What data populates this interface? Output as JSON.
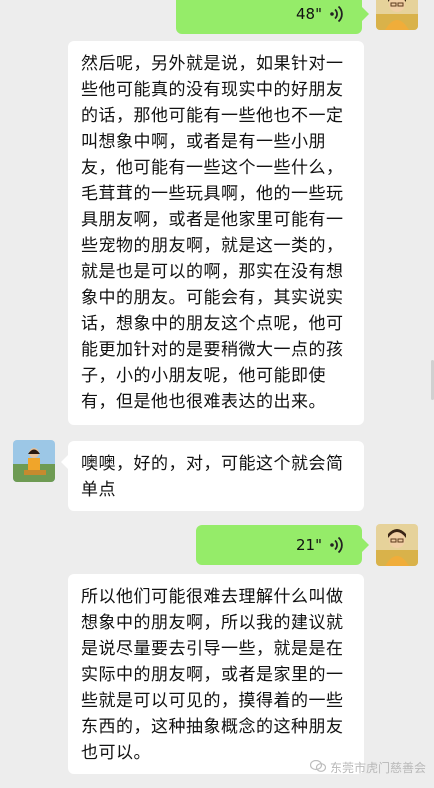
{
  "messages": [
    {
      "type": "voice",
      "sender": "self",
      "duration": "48\""
    },
    {
      "type": "text",
      "sender": "other",
      "text": "然后呢，另外就是说，如果针对一些他可能真的没有现实中的好朋友的话，那他可能有一些他也不一定叫想象中啊，或者是有一些小朋友，他可能有一些这个一些什么，毛茸茸的一些玩具啊，他的一些玩具朋友啊，或者是他家里可能有一些宠物的朋友啊，就是这一类的，就是也是可以的啊，那实在没有想象中的朋友。可能会有，其实说实话，想象中的朋友这个点呢，他可能更加针对的是要稍微大一点的孩子，小的小朋友呢，他可能即使有，但是他也很难表达的出来。"
    },
    {
      "type": "text",
      "sender": "other",
      "text": "噢噢，好的，对，可能这个就会简单点"
    },
    {
      "type": "voice",
      "sender": "self",
      "duration": "21\""
    },
    {
      "type": "text",
      "sender": "other",
      "text": "所以他们可能很难去理解什么叫做想象中的朋友啊，所以我的建议就是说尽量要去引导一些，就是是在实际中的朋友啊，或者是家里的一些就是可以可见的，摸得着的一些东西的，这种抽象概念的这种朋友也可以。"
    }
  ],
  "watermark": {
    "text": "东莞市虎门慈善会",
    "icon": "wechat-channel-icon"
  },
  "colors": {
    "background": "#ededed",
    "sent_bubble": "#95ec69",
    "received_bubble": "#ffffff"
  }
}
